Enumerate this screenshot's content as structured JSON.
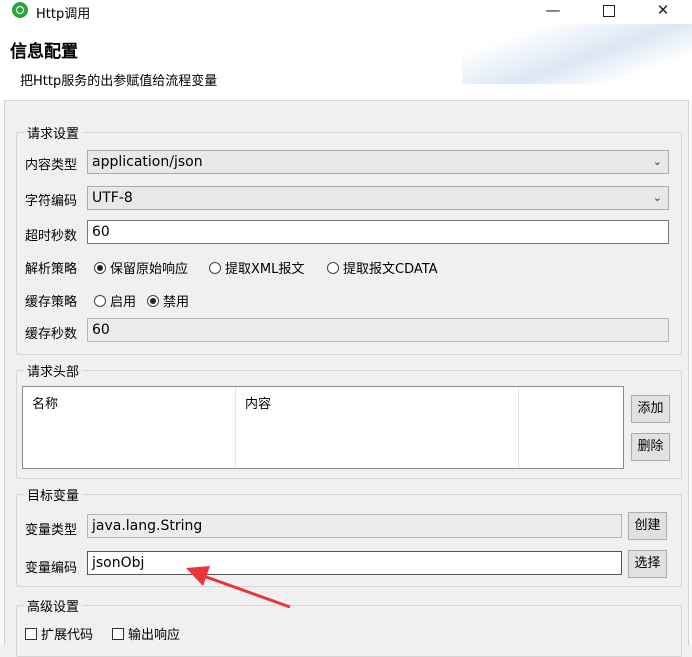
{
  "window": {
    "title": "Http调用",
    "minimize": "—",
    "close": "✕"
  },
  "header": {
    "title": "信息配置",
    "subtitle": "把Http服务的出参赋值给流程变量"
  },
  "request": {
    "legend": "请求设置",
    "content_type_label": "内容类型",
    "content_type_value": "application/json",
    "charset_label": "字符编码",
    "charset_value": "UTF-8",
    "timeout_label": "超时秒数",
    "timeout_value": "60",
    "parse_label": "解析策略",
    "parse_options": [
      "保留原始响应",
      "提取XML报文",
      "提取报文CDATA"
    ],
    "parse_selected": 0,
    "cache_label": "缓存策略",
    "cache_options": [
      "启用",
      "禁用"
    ],
    "cache_selected": 1,
    "cache_seconds_label": "缓存秒数",
    "cache_seconds_value": "60"
  },
  "headers": {
    "legend": "请求头部",
    "columns": [
      "名称",
      "内容"
    ],
    "add_button": "添加",
    "delete_button": "删除"
  },
  "target": {
    "legend": "目标变量",
    "var_type_label": "变量类型",
    "var_type_value": "java.lang.String",
    "create_button": "创建",
    "var_code_label": "变量编码",
    "var_code_value": "jsonObj",
    "select_button": "选择"
  },
  "advanced": {
    "legend": "高级设置",
    "options": [
      "扩展代码",
      "输出响应"
    ]
  },
  "annotation_color": "#e8363a"
}
